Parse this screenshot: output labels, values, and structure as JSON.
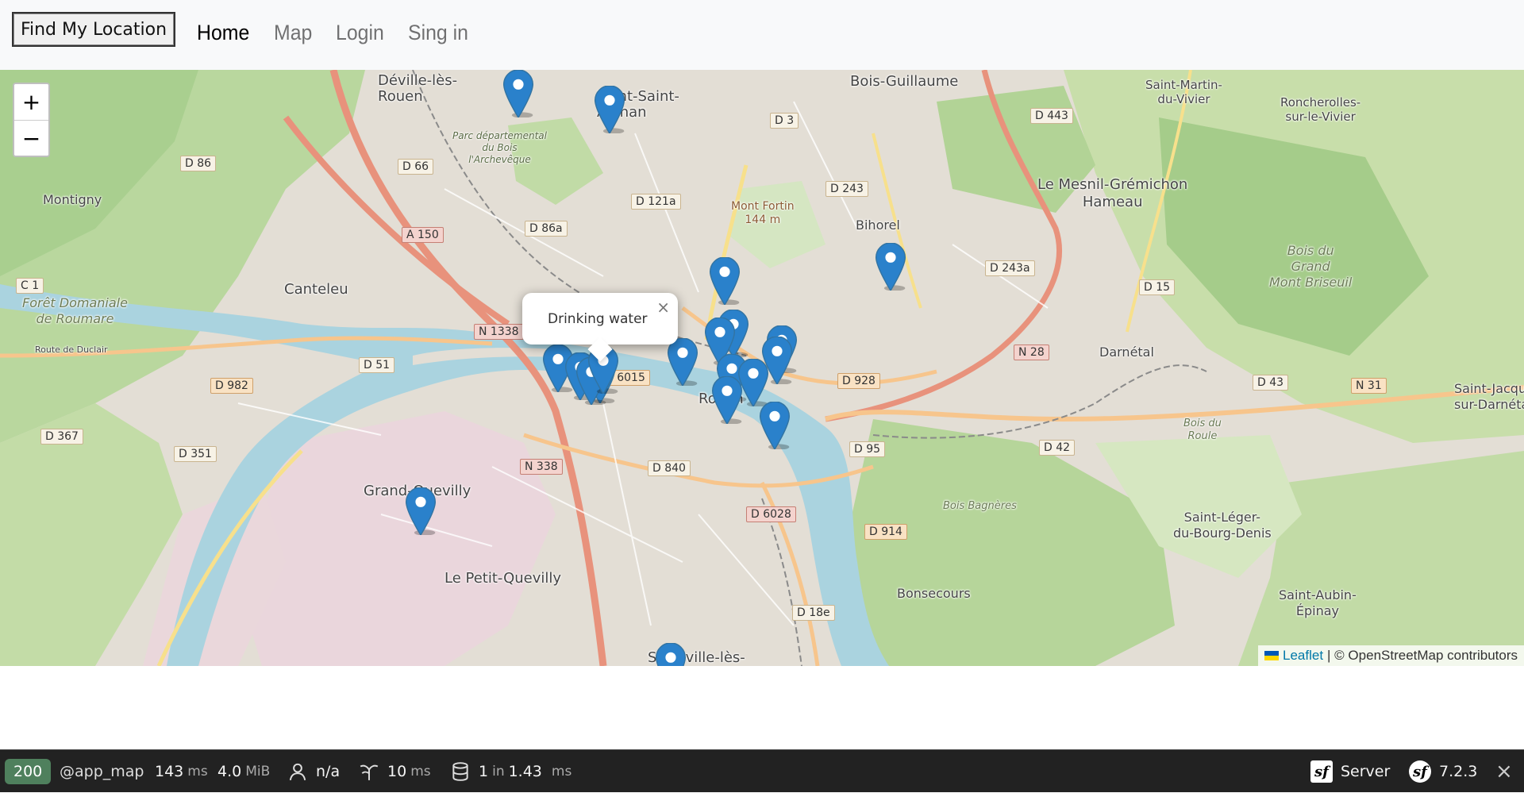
{
  "navbar": {
    "locate_button": "Find My Location",
    "links": [
      {
        "label": "Home",
        "active": true
      },
      {
        "label": "Map",
        "active": false
      },
      {
        "label": "Login",
        "active": false
      },
      {
        "label": "Sing in",
        "active": false
      }
    ]
  },
  "map": {
    "zoom_in": "+",
    "zoom_out": "−",
    "popup": {
      "text": "Drinking water",
      "close": "×"
    },
    "attribution": {
      "leaflet": "Leaflet",
      "rest": "| © OpenStreetMap contributors"
    },
    "place_labels": {
      "deville": "Déville-lès-\nRouen",
      "mont_saint_aignan": "Mont-Saint-\nAignan",
      "bois_guillaume": "Bois-Guillaume",
      "saint_martin": "Saint-Martin-\ndu-Vivier",
      "roncherolles": "Roncherolles-\nsur-le-Vivier",
      "montigny": "Montigny",
      "canteleu": "Canteleu",
      "foret": "Forêt Domaniale\nde Roumare",
      "route_duclair": "Route de Duclair",
      "mont_fortin": "Mont Fortin\n144 m",
      "bihorel": "Bihorel",
      "mesnil": "Le Mesnil-Grémichon\nHameau",
      "bois_grand": "Bois du\nGrand\nMont Briseuil",
      "darnetal": "Darnétal",
      "saint_jacques": "Saint-Jacques-\nsur-Darnétal",
      "rouen": "Rouen",
      "bois_roule": "Bois du\nRoule",
      "bois_bagneres": "Bois Bagnères",
      "saint_leger": "Saint-Léger-\ndu-Bourg-Denis",
      "grand_quevilly": "Grand-Quevilly",
      "petit_quevilly": "Le Petit-Quevilly",
      "bonsecours": "Bonsecours",
      "saint_aubin": "Saint-Aubin-\nÉpinay",
      "sotteville": "Sotteville-lès-\nRouen",
      "parc_departemental": "Parc départemental\ndu Bois\nl'Archevêque"
    },
    "road_shields": [
      "D 86",
      "D 66",
      "D 3",
      "D 443",
      "A 150",
      "D 86a",
      "D 121a",
      "D 243",
      "C 1",
      "D 243a",
      "D 15",
      "N 1338",
      "D 51",
      "D 982",
      "N 28",
      "D 928",
      "D 6015",
      "D 43",
      "N 31",
      "D 367",
      "D 351",
      "D 95",
      "D 42",
      "N 338",
      "D 840",
      "D 6028",
      "D 914",
      "D 18e"
    ],
    "markers_count": 20
  },
  "toolbar": {
    "status_code": "200",
    "route": "@app_map",
    "time_value": "143",
    "time_unit": "ms",
    "memory_value": "4.0",
    "memory_unit": "MiB",
    "user": "n/a",
    "twig_value": "10",
    "twig_unit": "ms",
    "db_count": "1",
    "db_in": "in",
    "db_time": "1.43",
    "db_unit": "ms",
    "server": "Server",
    "version": "7.2.3",
    "close": "×"
  }
}
